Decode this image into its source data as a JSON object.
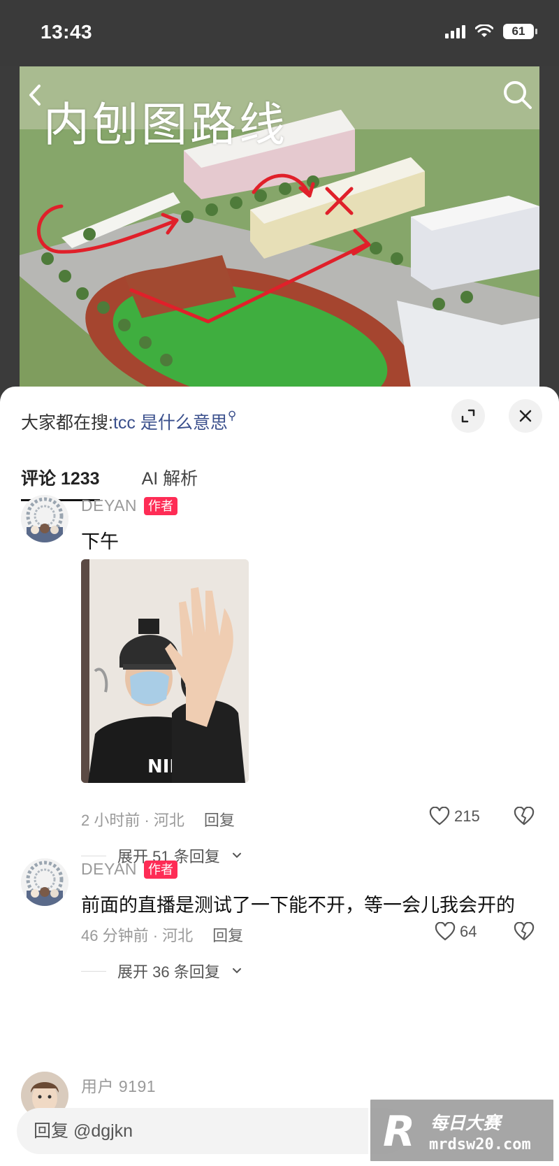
{
  "status_bar": {
    "time": "13:43",
    "battery": "61"
  },
  "hero": {
    "title": "内刨图路线"
  },
  "sheet": {
    "search_prefix": "大家都在搜:",
    "search_term": "tcc 是什么意思",
    "tabs": [
      {
        "label": "评论 1233"
      },
      {
        "label": "AI 解析"
      }
    ]
  },
  "comments": [
    {
      "username": "DEYAN",
      "badge": "作者",
      "text": "下午",
      "meta_time_location": "2 小时前 · 河北",
      "reply_label": "回复",
      "likes": "215",
      "expand_label": "展开 51 条回复"
    },
    {
      "username": "DEYAN",
      "badge": "作者",
      "text": "前面的直播是测试了一下能不开，等一会儿我会开的",
      "meta_time_location": "46 分钟前 · 河北",
      "reply_label": "回复",
      "likes": "64",
      "expand_label": "展开 36 条回复"
    },
    {
      "username": "用户 9191"
    }
  ],
  "reply_bar": {
    "placeholder": "回复 @dgjkn"
  },
  "watermark": {
    "logo": "R",
    "title": "每日大赛",
    "url": "mrdsw20.com"
  },
  "colors": {
    "badge": "#fe2c55",
    "search_term": "#3a4f8c",
    "annotation_red": "#e0202a"
  }
}
